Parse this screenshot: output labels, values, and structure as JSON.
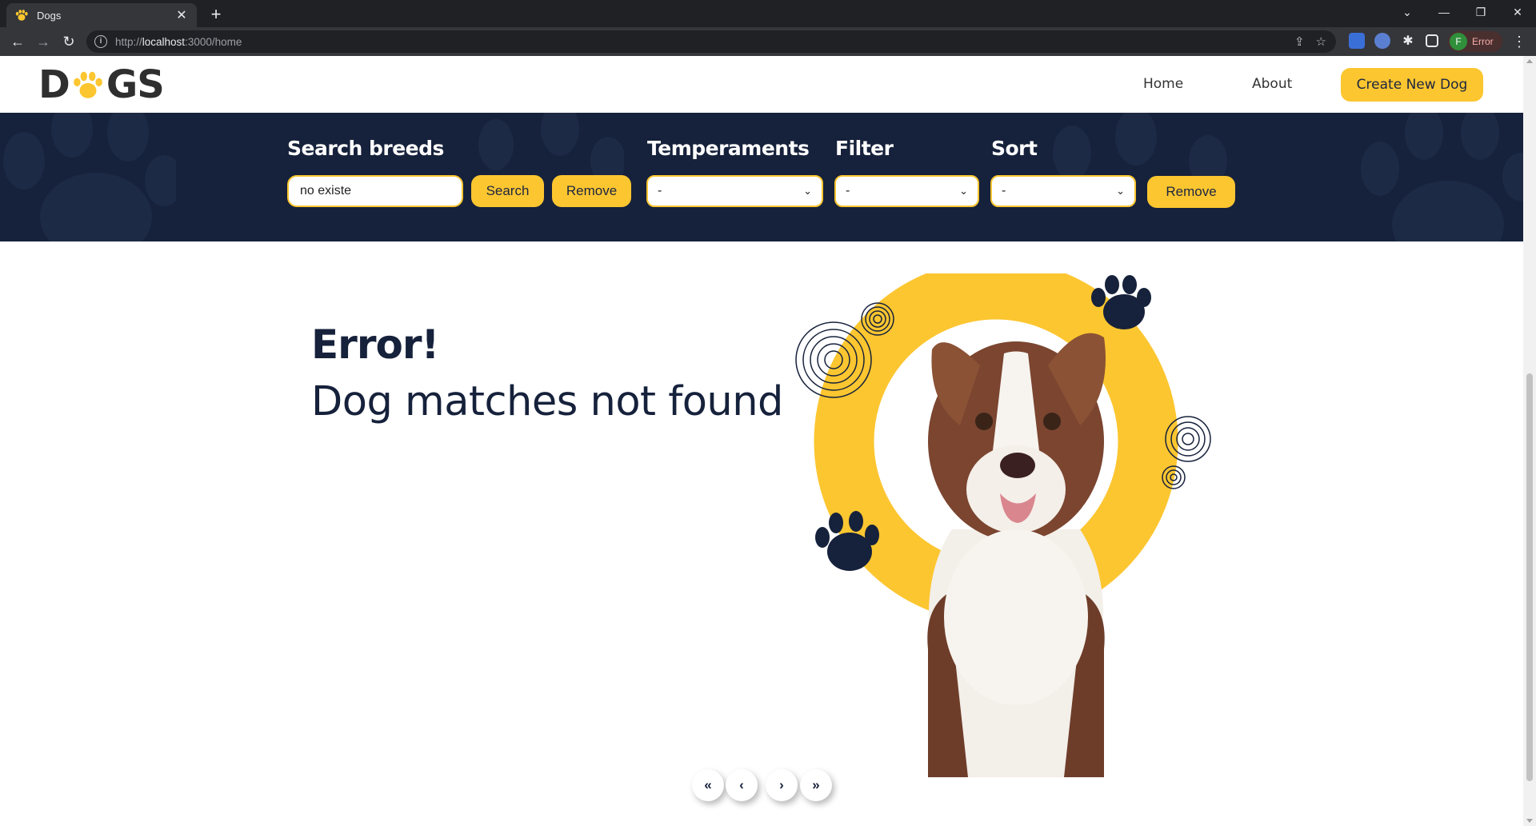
{
  "browser": {
    "tab_title": "Dogs",
    "url_prefix": "http://",
    "url_host": "localhost",
    "url_rest": ":3000/home",
    "profile_initial": "F",
    "profile_status": "Error"
  },
  "header": {
    "logo_left": "D",
    "logo_right": "GS",
    "nav": {
      "home": "Home",
      "about": "About"
    },
    "create_label": "Create New Dog"
  },
  "controls": {
    "search_label": "Search breeds",
    "search_value": "no existe",
    "search_button": "Search",
    "search_remove": "Remove",
    "temperaments_label": "Temperaments",
    "temperaments_value": "-",
    "filter_label": "Filter",
    "filter_value": "-",
    "sort_label": "Sort",
    "sort_value": "-",
    "remove_all": "Remove"
  },
  "error": {
    "title": "Error!",
    "message": "Dog matches not found"
  },
  "pagination": {
    "first": "«",
    "prev": "‹",
    "next": "›",
    "last": "»"
  },
  "colors": {
    "accent": "#fcc630",
    "navy": "#16213b",
    "band": "#16213b"
  },
  "icons": [
    "paw-icon",
    "back-icon",
    "forward-icon",
    "reload-icon",
    "info-icon",
    "share-icon",
    "star-icon",
    "extensions-icon",
    "sidepanel-icon",
    "menu-icon"
  ]
}
